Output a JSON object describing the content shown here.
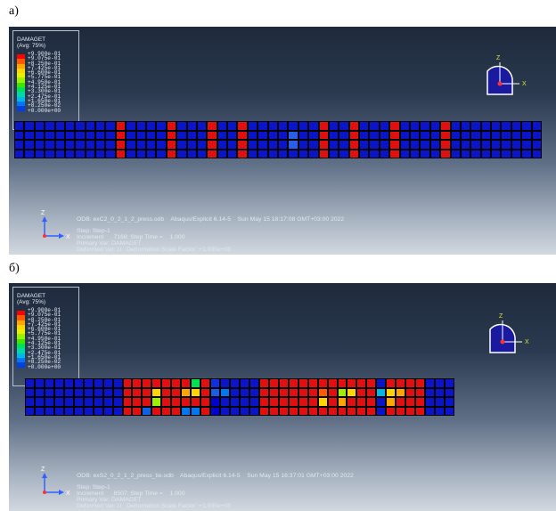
{
  "panels": [
    {
      "label": "a)",
      "legend": {
        "title": "DAMAGET",
        "subtitle": "(Avg: 75%)",
        "values": [
          "+9.900e-01",
          "+9.075e-01",
          "+8.250e-01",
          "+7.425e-01",
          "+6.600e-01",
          "+5.775e-01",
          "+4.950e-01",
          "+4.125e-01",
          "+3.300e-01",
          "+2.475e-01",
          "+1.650e-01",
          "+8.250e-02",
          "+0.000e+00"
        ],
        "colors": [
          "#ff0000",
          "#ff5a00",
          "#ffa500",
          "#ffd400",
          "#e6f000",
          "#9cf000",
          "#3ce600",
          "#00e050",
          "#00d8a8",
          "#00b8e8",
          "#0078f0",
          "#0040e0",
          "#0000d0"
        ]
      },
      "triad": {
        "top": "Z",
        "right": "X"
      },
      "footer_axes": {
        "up": "Z",
        "right": "X"
      },
      "info": {
        "odb": "ODB: exC2_0_2_1_2_press.odb    Abaqus/Explicit 6.14-5    Sun May 15 18:17:08 GMT+03:00 2022",
        "step": "Step: Step-1",
        "increment": "Increment      7168: Step Time =    1.000",
        "primary": "Primary Var: DAMAGET",
        "deformed": "Deformed Var: U   Deformation Scale Factor: +1.000e+00"
      }
    },
    {
      "label": "б)",
      "legend": {
        "title": "DAMAGET",
        "subtitle": "(Avg: 75%)",
        "values": [
          "+9.900e-01",
          "+9.075e-01",
          "+8.250e-01",
          "+7.425e-01",
          "+6.600e-01",
          "+5.775e-01",
          "+4.950e-01",
          "+4.125e-01",
          "+3.300e-01",
          "+2.475e-01",
          "+1.650e-01",
          "+8.250e-02",
          "+0.000e+00"
        ],
        "colors": [
          "#ff0000",
          "#ff5a00",
          "#ffa500",
          "#ffd400",
          "#e6f000",
          "#9cf000",
          "#3ce600",
          "#00e050",
          "#00d8a8",
          "#00b8e8",
          "#0078f0",
          "#0040e0",
          "#0000d0"
        ]
      },
      "triad": {
        "top": "Z",
        "right": "X"
      },
      "footer_axes": {
        "up": "Z",
        "right": "X"
      },
      "info": {
        "odb": "ODB: exS2_0_2_1_2_press_tie.odb    Abaqus/Explicit 6.14-5    Sun May 15 16:37:01 GMT+03:00 2022",
        "step": "Step: Step-1",
        "increment": "Increment      8507: Step Time =    1.000",
        "primary": "Primary Var: DAMAGET",
        "deformed": "Deformed Var: U   Deformation Scale Factor: +1.000e+00"
      }
    }
  ]
}
